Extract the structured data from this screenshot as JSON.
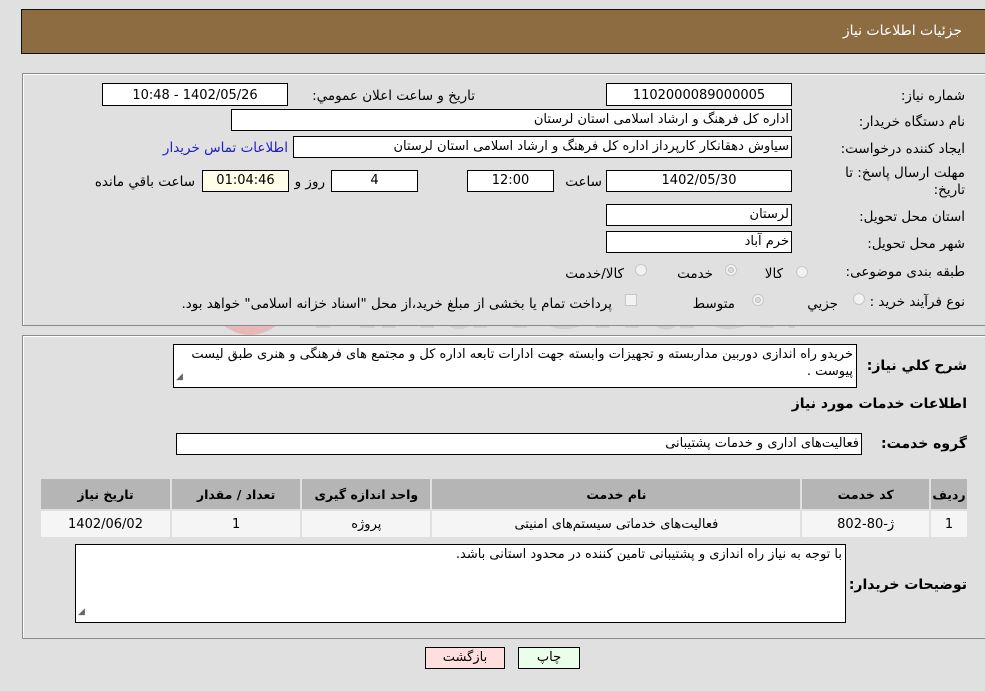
{
  "header": {
    "title": "جزئیات اطلاعات نیاز"
  },
  "form": {
    "need_number_label": "شماره نیاز:",
    "need_number": "1102000089000005",
    "announce_label": "تاریخ و ساعت اعلان عمومي:",
    "announce_value": "1402/05/26 - 10:48",
    "buyer_org_label": "نام دستگاه خریدار:",
    "buyer_org": "اداره کل فرهنگ و ارشاد اسلامی استان لرستان",
    "creator_label": "ایجاد کننده درخواست:",
    "creator": "سیاوش دهقانکار کارپرداز اداره کل فرهنگ و ارشاد اسلامی استان لرستان",
    "contact_link": "اطلاعات تماس خریدار",
    "deadline_label_1": "مهلت ارسال پاسخ: تا",
    "deadline_label_2": "تاریخ:",
    "deadline_date": "1402/05/30",
    "time_label": "ساعت",
    "deadline_time": "12:00",
    "days_value": "4",
    "days_label": "روز و",
    "remaining_value": "01:04:46",
    "remaining_label": "ساعت باقي مانده",
    "province_label": "استان محل تحویل:",
    "province": "لرستان",
    "city_label": "شهر محل تحویل:",
    "city": "خرم آباد",
    "category_label": "طبقه بندی موضوعی:",
    "category_options": [
      {
        "label": "کالا",
        "checked": false
      },
      {
        "label": "خدمت",
        "checked": true
      },
      {
        "label": "کالا/خدمت",
        "checked": false
      }
    ],
    "process_label": "نوع فرآیند خرید :",
    "process_options": [
      {
        "label": "جزيي",
        "checked": false
      },
      {
        "label": "متوسط",
        "checked": true
      }
    ],
    "treasury_note": "پرداخت تمام یا بخشی از مبلغ خرید،از محل \"اسناد خزانه اسلامی\" خواهد بود."
  },
  "description": {
    "label": "شرح کلي نیاز:",
    "text": "خریدو راه اندازی  دوربین مداربسته  و تجهیزات وابسته جهت ادارات تابعه اداره کل  و مجتمع های فرهنگی و هنری طبق لیست پیوست ."
  },
  "services": {
    "section_title": "اطلاعات خدمات مورد نیاز",
    "group_label": "گروه خدمت:",
    "group_value": "فعالیت‌های اداری و خدمات پشتیبانی",
    "columns": [
      "ردیف",
      "کد خدمت",
      "نام خدمت",
      "واحد اندازه گیری",
      "تعداد / مقدار",
      "تاریخ نیاز"
    ],
    "rows": [
      [
        "1",
        "ژ-80-802",
        "فعالیت‌های خدماتی سیستم‌های امنیتی",
        "پروژه",
        "1",
        "1402/06/02"
      ]
    ]
  },
  "buyer_notes": {
    "label": "توضیحات خریدار:",
    "text": "با توجه به نیاز راه اندازی و پشتیبانی تامین کننده در محدود استانی باشد."
  },
  "buttons": {
    "print": "چاپ",
    "back": "بازگشت"
  },
  "watermark": {
    "text": "AriaTender.neT"
  },
  "colors": {
    "header": "#8d6c42",
    "print_bg": "#eaffea",
    "back_bg": "#ffdede",
    "link": "#2020c0"
  }
}
